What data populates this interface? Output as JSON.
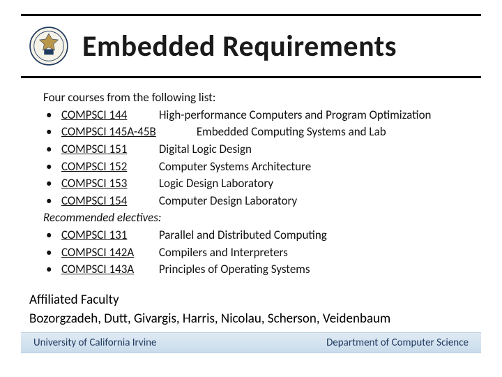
{
  "title": "Embedded Requirements",
  "intro": "Four courses from the following list:",
  "courses_required": [
    {
      "code": "COMPSCI 144",
      "title": "High-performance Computers and Program Optimization"
    },
    {
      "code": "COMPSCI 145A-45B",
      "title": "Embedded Computing Systems and Lab",
      "wide": true
    },
    {
      "code": "COMPSCI 151",
      "title": "Digital Logic Design"
    },
    {
      "code": "COMPSCI 152",
      "title": "Computer Systems Architecture"
    },
    {
      "code": "COMPSCI 153",
      "title": "Logic Design Laboratory"
    },
    {
      "code": "COMPSCI 154",
      "title": "Computer Design Laboratory"
    }
  ],
  "electives_heading": "Recommended electives:",
  "courses_elective": [
    {
      "code": "COMPSCI 131",
      "title": "Parallel and Distributed Computing"
    },
    {
      "code": "COMPSCI 142A",
      "title": "Compilers and Interpreters"
    },
    {
      "code": "COMPSCI 143A",
      "title": "Principles of Operating Systems"
    }
  ],
  "faculty_heading": "Affiliated Faculty",
  "faculty_names": "Bozorgzadeh, Dutt, Givargis, Harris, Nicolau, Scherson, Veidenbaum",
  "footer_left": "University of California Irvine",
  "footer_right": "Department of Computer Science"
}
